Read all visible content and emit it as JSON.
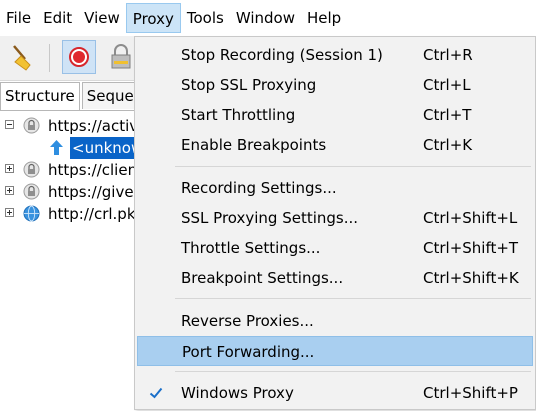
{
  "menubar": {
    "items": [
      "File",
      "Edit",
      "View",
      "Proxy",
      "Tools",
      "Window",
      "Help"
    ]
  },
  "tabs": [
    "Structure",
    "Seque"
  ],
  "tree": [
    {
      "text": "https://activ",
      "expander": "minus",
      "icon": "lock-icon"
    },
    {
      "text": "<unknow",
      "selected": true,
      "icon": "arrow-up-icon"
    },
    {
      "text": "https://clien",
      "expander": "plus",
      "icon": "lock-icon"
    },
    {
      "text": "https://give",
      "expander": "plus",
      "icon": "lock-icon"
    },
    {
      "text": "http://crl.pk",
      "expander": "plus",
      "icon": "globe-icon"
    }
  ],
  "proxy_menu": {
    "groups": [
      [
        {
          "label": "Stop Recording (Session 1)",
          "shortcut": "Ctrl+R"
        },
        {
          "label": "Stop SSL Proxying",
          "shortcut": "Ctrl+L"
        },
        {
          "label": "Start Throttling",
          "shortcut": "Ctrl+T"
        },
        {
          "label": "Enable Breakpoints",
          "shortcut": "Ctrl+K"
        }
      ],
      [
        {
          "label": "Recording Settings...",
          "shortcut": ""
        },
        {
          "label": "SSL Proxying Settings...",
          "shortcut": "Ctrl+Shift+L"
        },
        {
          "label": "Throttle Settings...",
          "shortcut": "Ctrl+Shift+T"
        },
        {
          "label": "Breakpoint Settings...",
          "shortcut": "Ctrl+Shift+K"
        }
      ],
      [
        {
          "label": "Reverse Proxies...",
          "shortcut": ""
        },
        {
          "label": "Port Forwarding...",
          "shortcut": "",
          "highlighted": true
        }
      ],
      [
        {
          "label": "Windows Proxy",
          "shortcut": "Ctrl+Shift+P",
          "checked": true
        }
      ]
    ]
  },
  "colors": {
    "menu_highlight": "#a9cff0",
    "active_menu": "#cce4f7",
    "selection": "#0a64c8",
    "check": "#1a6fc9"
  }
}
